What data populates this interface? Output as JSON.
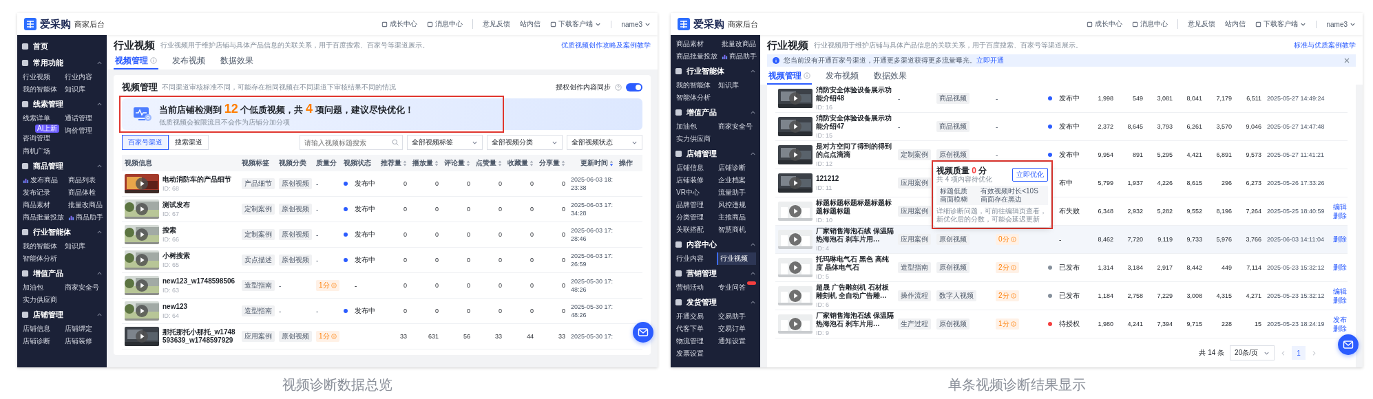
{
  "panels": [
    {
      "logo": {
        "brand": "爱采购",
        "subtitle": "商家后台"
      },
      "header_links": [
        {
          "label": "成长中心",
          "icon": true
        },
        {
          "label": "消息中心",
          "icon": true
        },
        {
          "label": "意见反馈",
          "divider_before": true
        },
        {
          "label": "站内信"
        },
        {
          "label": "下载客户端",
          "icon": true,
          "dropdown": true
        },
        {
          "label": "name3",
          "dropdown": true,
          "divider_before": true
        }
      ],
      "sidebar": [
        {
          "title": "首页"
        },
        {
          "title": "常用功能",
          "expanded": true,
          "items": [
            {
              "label": "行业视频",
              "selected": false
            },
            {
              "label": "行业内容",
              "selected": false
            },
            {
              "label": "我的智能体",
              "selected": false
            },
            {
              "label": "知识库",
              "selected": false
            }
          ]
        },
        {
          "title": "线索管理",
          "expanded": true,
          "items": [
            {
              "label": "线索详单",
              "selected": false
            },
            {
              "label": "通话管理",
              "selected": false
            },
            {
              "label": "咨询管理",
              "selected": false,
              "badge": "AI上新"
            },
            {
              "label": "询价管理",
              "selected": false
            },
            {
              "label": "商机广场",
              "selected": false
            }
          ]
        },
        {
          "title": "商品管理",
          "expanded": true,
          "items": [
            {
              "label": "发布商品",
              "selected": false,
              "has_icon": true
            },
            {
              "label": "商品列表",
              "selected": false
            },
            {
              "label": "发布记录",
              "selected": false
            },
            {
              "label": "商品体检",
              "selected": false
            },
            {
              "label": "商品素材",
              "selected": false
            },
            {
              "label": "批量改商品",
              "selected": false
            },
            {
              "label": "商品批量投放",
              "selected": false
            },
            {
              "label": "商品助手",
              "selected": false,
              "has_icon": true
            }
          ]
        },
        {
          "title": "行业智能体",
          "expanded": true,
          "items": [
            {
              "label": "我的智能体",
              "selected": false
            },
            {
              "label": "知识库",
              "selected": false
            },
            {
              "label": "智能体分析",
              "selected": false
            }
          ]
        },
        {
          "title": "增值产品",
          "expanded": true,
          "items": [
            {
              "label": "加油包",
              "selected": false
            },
            {
              "label": "商家安全号",
              "selected": false
            },
            {
              "label": "实力供应商",
              "selected": false
            }
          ]
        },
        {
          "title": "店铺管理",
          "expanded": true,
          "items": [
            {
              "label": "店铺信息",
              "selected": false
            },
            {
              "label": "店铺绑定",
              "selected": false
            },
            {
              "label": "店铺诊断",
              "selected": false
            },
            {
              "label": "店铺装修",
              "selected": false
            }
          ]
        }
      ],
      "page": {
        "title": "行业视频",
        "description": "行业视频用于维护店铺与具体产品信息的关联关系，用于百度搜索、百家号等渠道展示。",
        "guide_link": "优质视频创作攻略及案例教学",
        "tabs": [
          {
            "label": "视频管理",
            "selected": true,
            "info": true
          },
          {
            "label": "发布视频",
            "selected": false
          },
          {
            "label": "数据效果",
            "selected": false
          }
        ]
      },
      "card": {
        "title": "视频管理",
        "subtitle": "不同渠道审核标准不同，可能存在相同视频在不同渠道下审核结果不同的情况",
        "sync": {
          "label": "授权创作内容同步",
          "on": true
        },
        "alert": {
          "text": "当前店铺检测到 **12** 个低质视频，共 **4** 项问题，建议尽快优化！",
          "hint": "低质视频会被限流且不会作为店铺分加分项",
          "highlighted": true
        },
        "channels": [
          {
            "label": "百家号渠道",
            "selected": true
          },
          {
            "label": "搜索渠道",
            "selected": false
          }
        ],
        "search": {
          "placeholder": "请输入视频标题搜索"
        },
        "filters": [
          "全部视频标签",
          "全部视频分类",
          "全部视频状态"
        ]
      },
      "table": {
        "columns": [
          {
            "label": "视频信息"
          },
          {
            "label": "视频标签"
          },
          {
            "label": "视频分类"
          },
          {
            "label": "质量分"
          },
          {
            "label": "视频状态"
          },
          {
            "label": "推荐量",
            "sortable": true,
            "sorted": false
          },
          {
            "label": "播放量",
            "sortable": true,
            "sorted": false
          },
          {
            "label": "评论量",
            "sortable": true,
            "sorted": false
          },
          {
            "label": "点赞量",
            "sortable": true,
            "sorted": false
          },
          {
            "label": "收藏量",
            "sortable": true,
            "sorted": false
          },
          {
            "label": "分享量",
            "sortable": true,
            "sorted": false
          },
          {
            "label": "更新时间",
            "sortable": true,
            "sorted": true
          },
          {
            "label": "操作"
          }
        ],
        "rows": [
          {
            "title": "电动消防车的产品细节",
            "id": "ID: 68",
            "tag": {
              "text": "产品细节",
              "chip": true
            },
            "category": {
              "text": "原创视频",
              "chip": true
            },
            "quality": "-",
            "quality_badge": false,
            "status": {
              "text": "发布中",
              "color": "#2b5cff"
            },
            "stats": [
              "0",
              "0",
              "0",
              "0",
              "0",
              "0"
            ],
            "updated": "2025-06-03 18:23:38"
          },
          {
            "title": "测试发布",
            "id": "ID: 67",
            "tag": {
              "text": "定制案例",
              "chip": true
            },
            "category": {
              "text": "原创视频",
              "chip": true
            },
            "quality": "-",
            "quality_badge": false,
            "status": {
              "text": "发布中",
              "color": "#2b5cff"
            },
            "stats": [
              "0",
              "0",
              "0",
              "0",
              "0",
              "0"
            ],
            "updated": "2025-06-03 17:34:28"
          },
          {
            "title": "搜索",
            "id": "ID: 66",
            "tag": {
              "text": "定制案例",
              "chip": true
            },
            "category": {
              "text": "原创视频",
              "chip": true
            },
            "quality": "-",
            "quality_badge": false,
            "status": {
              "text": "发布中",
              "color": "#2b5cff"
            },
            "stats": [
              "0",
              "0",
              "0",
              "0",
              "0",
              "0"
            ],
            "updated": "2025-06-03 17:28:46"
          },
          {
            "title": "小树搜索",
            "id": "ID: 65",
            "tag": {
              "text": "卖点描述",
              "chip": true
            },
            "category": {
              "text": "原创视频",
              "chip": true
            },
            "quality": "-",
            "quality_badge": false,
            "status": {
              "text": "发布中",
              "color": "#2b5cff"
            },
            "stats": [
              "0",
              "0",
              "0",
              "0",
              "0",
              "0"
            ],
            "updated": "2025-06-03 17:26:59"
          },
          {
            "title": "new123_w1748598506",
            "id": "ID: 63",
            "tag": {
              "text": "造型指南",
              "chip": true
            },
            "category": {
              "text": "-",
              "chip": false
            },
            "quality": "1分",
            "quality_badge": true,
            "status": {
              "text": "-"
            },
            "stats": [
              "0",
              "0",
              "0",
              "0",
              "0",
              "0"
            ],
            "updated": "2025-05-30 17:48:26"
          },
          {
            "title": "new123",
            "id": "ID: 64",
            "tag": {
              "text": "造型指南",
              "chip": true
            },
            "category": {
              "text": "-",
              "chip": false
            },
            "quality": "-",
            "quality_badge": false,
            "status": {
              "text": "发布中",
              "color": "#2b5cff"
            },
            "stats": [
              "0",
              "0",
              "0",
              "0",
              "0",
              "0"
            ],
            "updated": "2025-05-30 17:48:26"
          },
          {
            "title": "那托那托小那托_w1748593639_w1748597929",
            "tag": {
              "text": "应用案例",
              "chip": true
            },
            "category": {
              "text": "原创视频",
              "chip": true
            },
            "quality": "1分",
            "quality_badge": true,
            "stats": [
              "33",
              "631",
              "56",
              "33",
              "44",
              "33"
            ],
            "updated": "2025-05-30 17:"
          }
        ]
      },
      "caption": "视频诊断数据总览"
    },
    {
      "logo": {
        "brand": "爱采购",
        "subtitle": "商家后台"
      },
      "header_links": [
        {
          "label": "成长中心",
          "icon": true
        },
        {
          "label": "消息中心",
          "icon": true
        },
        {
          "label": "意见反馈",
          "divider_before": true
        },
        {
          "label": "站内信"
        },
        {
          "label": "下载客户端",
          "icon": true,
          "dropdown": true
        },
        {
          "label": "name3",
          "dropdown": true,
          "divider_before": true
        }
      ],
      "sidebar": [
        {
          "items": [
            {
              "label": "商品素材",
              "selected": false
            },
            {
              "label": "批量改商品",
              "selected": false
            },
            {
              "label": "商品批量投放",
              "selected": false
            },
            {
              "label": "商品助手",
              "selected": false,
              "has_icon": true
            }
          ]
        },
        {
          "title": "行业智能体",
          "expanded": true,
          "items": [
            {
              "label": "我的智能体",
              "selected": false
            },
            {
              "label": "知识库",
              "selected": false
            },
            {
              "label": "智能体分析",
              "selected": false
            }
          ]
        },
        {
          "title": "增值产品",
          "expanded": true,
          "items": [
            {
              "label": "加油包",
              "selected": false
            },
            {
              "label": "商家安全号",
              "selected": false
            },
            {
              "label": "实力供应商",
              "selected": false
            }
          ]
        },
        {
          "title": "店铺管理",
          "expanded": true,
          "items": [
            {
              "label": "店铺信息",
              "selected": false
            },
            {
              "label": "店铺诊断",
              "selected": false
            },
            {
              "label": "店铺装修",
              "selected": false
            },
            {
              "label": "企业档案",
              "selected": false
            },
            {
              "label": "VR中心",
              "selected": false
            },
            {
              "label": "流量助手",
              "selected": false
            },
            {
              "label": "品牌管理",
              "selected": false
            },
            {
              "label": "风控违规",
              "selected": false
            },
            {
              "label": "分类管理",
              "selected": false
            },
            {
              "label": "主推商品",
              "selected": false
            },
            {
              "label": "关联搭配",
              "selected": false
            },
            {
              "label": "智慧商机",
              "selected": false
            }
          ]
        },
        {
          "title": "内容中心",
          "expanded": true,
          "items": [
            {
              "label": "行业内容",
              "selected": false
            },
            {
              "label": "行业视频",
              "selected": true
            }
          ]
        },
        {
          "title": "营销管理",
          "expanded": true,
          "items": [
            {
              "label": "营销活动",
              "selected": false
            },
            {
              "label": "专业问答",
              "selected": false,
              "flagged": true
            }
          ]
        },
        {
          "title": "发货管理",
          "expanded": true,
          "items": [
            {
              "label": "开通交易",
              "selected": false
            },
            {
              "label": "交易助手",
              "selected": false
            },
            {
              "label": "代客下单",
              "selected": false
            },
            {
              "label": "交易订单",
              "selected": false
            },
            {
              "label": "物流管理",
              "selected": false
            },
            {
              "label": "通知设置",
              "selected": false
            },
            {
              "label": "发票设置",
              "selected": false
            }
          ]
        }
      ],
      "page": {
        "title": "行业视频",
        "description": "行业视频用于维护店铺与具体产品信息的关联关系，用于百度搜索、百家号等渠道展示。",
        "guide_link": "标准与优质案例教学",
        "notice": {
          "text": "您当前没有开通百家号渠道，开通更多渠道获得更多流量曝光。",
          "link": "立即开通"
        },
        "tabs": [
          {
            "label": "视频管理",
            "selected": true,
            "info": true
          },
          {
            "label": "发布视频",
            "selected": false
          },
          {
            "label": "数据效果",
            "selected": false
          }
        ]
      },
      "table": {
        "rows": [
          {
            "title": "消防安全体验设备展示功能介绍48",
            "id": "ID: 16",
            "tag": {
              "text": "-",
              "chip": false
            },
            "category": {
              "text": "商品视频",
              "chip": true
            },
            "quality": "-",
            "quality_badge": false,
            "status": {
              "text": "发布中",
              "color": "#2b5cff"
            },
            "stats": [
              "1,998",
              "549",
              "3,081",
              "8,041",
              "7,179",
              "6,511"
            ],
            "updated": "2025-05-27 14:49:24",
            "highlighted": false
          },
          {
            "title": "消防安全体验设备展示功能介绍47",
            "id": "ID: 15",
            "tag": {
              "text": "-",
              "chip": false
            },
            "category": {
              "text": "商品视频",
              "chip": true
            },
            "quality": "-",
            "quality_badge": false,
            "status": {
              "text": "发布中",
              "color": "#2b5cff"
            },
            "stats": [
              "2,372",
              "8,645",
              "3,793",
              "6,261",
              "3,570",
              "9,046"
            ],
            "updated": "2025-05-27 14:47:48",
            "highlighted": false
          },
          {
            "title": "是对方空间了得到的得到的点点滴滴",
            "id": "ID: 12",
            "tag": {
              "text": "定制案例",
              "chip": true
            },
            "category": {
              "text": "原创视频",
              "chip": true
            },
            "quality": "-",
            "quality_badge": false,
            "status": {
              "text": "发布中",
              "color": "#2b5cff"
            },
            "stats": [
              "9,954",
              "891",
              "5,295",
              "4,421",
              "6,891",
              "9,573"
            ],
            "updated": "2025-05-27 11:41:21",
            "highlighted": false
          },
          {
            "title": "121212",
            "id": "ID: 11",
            "tag": {
              "text": "应用案例",
              "chip": true
            },
            "status": {
              "text": "布中"
            },
            "stats": [
              "5,799",
              "1,937",
              "4,226",
              "8,615",
              "296",
              "6,273"
            ],
            "updated": "2025-05-26 17:33:26",
            "highlighted": false
          },
          {
            "title": "标题标题标题标题标题标题标题标题",
            "id": "ID: 10",
            "tag": {
              "text": "应用案例",
              "chip": true
            },
            "status": {
              "text": "布失败"
            },
            "stats": [
              "6,348",
              "2,932",
              "5,282",
              "9,552",
              "8,196",
              "7,264"
            ],
            "updated": "2025-05-25 18:40:59",
            "actions": [
              "编辑",
              "删除"
            ],
            "highlighted": false
          },
          {
            "title": "厂家销售海泡石绒 保温隔热海泡石 刹车片用…",
            "id": "ID: 4",
            "tag": {
              "text": "应用案例",
              "chip": true
            },
            "category": {
              "text": "原创视频",
              "chip": true
            },
            "quality": "0分",
            "quality_badge": true,
            "status": {
              "text": "-"
            },
            "stats": [
              "8,462",
              "7,720",
              "9,119",
              "9,733",
              "5,976",
              "3,766"
            ],
            "updated": "2025-06-03 14:11:04",
            "actions": [
              "删除"
            ],
            "highlighted": true
          },
          {
            "title": "托玛琳电气石 黑色 高纯度 晶体电气石",
            "id": "ID: 5",
            "tag": {
              "text": "造型指南",
              "chip": true
            },
            "category": {
              "text": "原创视频",
              "chip": true
            },
            "quality": "2分",
            "quality_badge": true,
            "status": {
              "text": "已发布",
              "color": "#86909c"
            },
            "stats": [
              "1,314",
              "3,184",
              "2,917",
              "8,442",
              "449",
              "7,114"
            ],
            "updated": "2025-05-23 15:32:12",
            "actions": [
              "删除"
            ],
            "highlighted": false
          },
          {
            "title": "超晟 广告雕刻机 石材板雕刻机 全自动广告雕…",
            "id": "ID: 6",
            "tag": {
              "text": "操作流程",
              "chip": true
            },
            "category": {
              "text": "数字人视频",
              "chip": true
            },
            "quality": "2分",
            "quality_badge": true,
            "status": {
              "text": "已发布",
              "color": "#86909c"
            },
            "stats": [
              "1,184",
              "2,758",
              "7,229",
              "3,008",
              "4,315",
              "4,271"
            ],
            "updated": "2025-05-23 15:32:12",
            "actions": [
              "编辑",
              "删除"
            ],
            "highlighted": false
          },
          {
            "title": "厂家销售海泡石绒 保温隔热海泡石 刹车片用…",
            "id": "ID: 9",
            "tag": {
              "text": "生产过程",
              "chip": true
            },
            "category": {
              "text": "原创视频",
              "chip": true
            },
            "quality": "1分",
            "quality_badge": true,
            "status": {
              "text": "待授权",
              "color": "#f53f3f"
            },
            "stats": [
              "1,980",
              "4,241",
              "7,394",
              "9,715",
              "228",
              "15"
            ],
            "updated": "2025-05-23 18:24:19",
            "actions": [
              "发布",
              "删除"
            ],
            "highlighted": false
          }
        ]
      },
      "popup": {
        "title": "视频质量 **0** 分",
        "subtitle": "共 4 项内容待优化",
        "button": "立即优化",
        "issues": [
          "标题低质",
          "有效视频时长<10S",
          "画面模糊",
          "画面存在黑边"
        ],
        "note": "详细诊断问题，可前往编辑页查看，新优化后的分数，可能会延迟更新",
        "highlighted": true
      },
      "pagination": {
        "total": "共 14 条",
        "page_size": "20条/页",
        "pages": [
          {
            "label": "1",
            "selected": true
          }
        ]
      },
      "caption": "单条视频诊断结果显示"
    }
  ]
}
